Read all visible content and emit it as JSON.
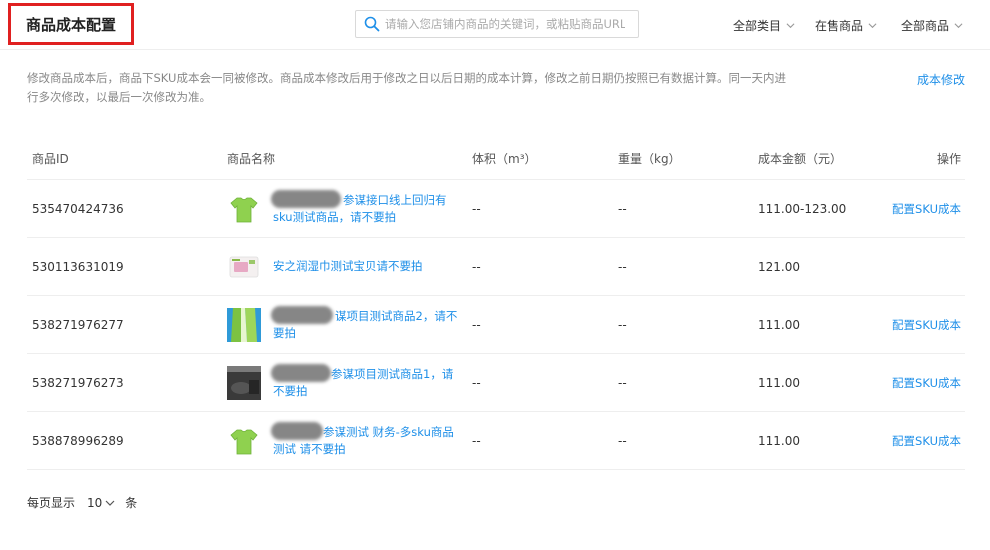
{
  "header": {
    "title": "商品成本配置",
    "search_placeholder": "请输入您店铺内商品的关键词，或粘贴商品URL",
    "filters": [
      "全部类目",
      "在售商品",
      "全部商品"
    ]
  },
  "notice": {
    "text": "修改商品成本后，商品下SKU成本会一同被修改。商品成本修改后用于修改之日以后日期的成本计算，修改之前日期仍按照已有数据计算。同一天内进行多次修改，以最后一次修改为准。",
    "action_label": "成本修改"
  },
  "table": {
    "columns": [
      "商品ID",
      "商品名称",
      "体积（m³）",
      "重量（kg）",
      "成本金额（元）",
      "操作"
    ],
    "rows": [
      {
        "id": "535470424736",
        "name": "参谋接口线上回归有sku测试商品，请不要拍",
        "volume": "--",
        "weight": "--",
        "cost": "111.00-123.00",
        "action": "配置SKU成本",
        "thumb": "green-tshirt"
      },
      {
        "id": "530113631019",
        "name": "安之润湿巾测试宝贝请不要拍",
        "volume": "--",
        "weight": "--",
        "cost": "121.00",
        "action": "",
        "thumb": "wipes-pack"
      },
      {
        "id": "538271976277",
        "name": "谋项目测试商品2，请不要拍",
        "volume": "--",
        "weight": "--",
        "cost": "111.00",
        "action": "配置SKU成本",
        "thumb": "green-fabric"
      },
      {
        "id": "538271976273",
        "name": "参谋项目测试商品1，请不要拍",
        "volume": "--",
        "weight": "--",
        "cost": "111.00",
        "action": "配置SKU成本",
        "thumb": "dark-photo"
      },
      {
        "id": "538878996289",
        "name": "参谋测试 财务-多sku商品测试 请不要拍",
        "volume": "--",
        "weight": "--",
        "cost": "111.00",
        "action": "配置SKU成本",
        "thumb": "green-tshirt"
      }
    ]
  },
  "pager": {
    "label": "每页显示",
    "page_size": "10",
    "unit": "条"
  },
  "colors": {
    "accent": "#1e8fe8",
    "highlight_border": "#e02020"
  }
}
